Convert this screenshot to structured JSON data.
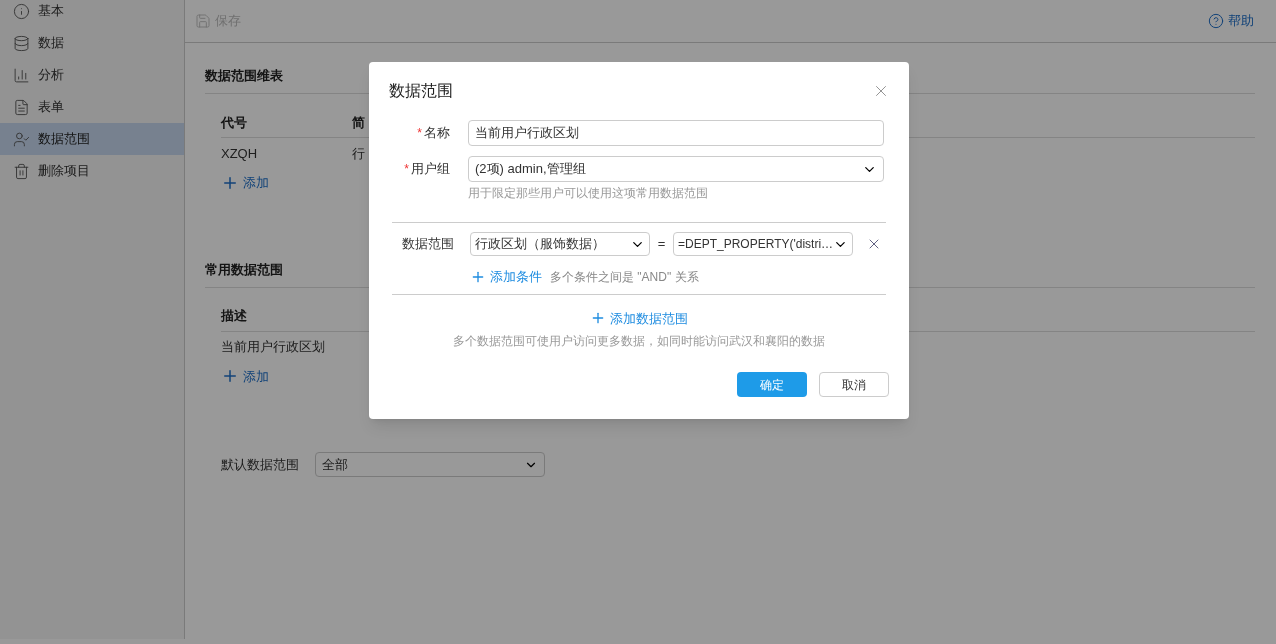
{
  "sidebar": {
    "items": [
      {
        "label": "基本",
        "selected": false
      },
      {
        "label": "数据",
        "selected": false
      },
      {
        "label": "分析",
        "selected": false
      },
      {
        "label": "表单",
        "selected": false
      },
      {
        "label": "数据范围",
        "selected": true
      },
      {
        "label": "删除项目",
        "selected": false
      }
    ]
  },
  "toolbar": {
    "save": {
      "label": "保存",
      "disabled": true
    },
    "help": "帮助"
  },
  "dimension_table": {
    "title": "数据范围维表",
    "columns": [
      "代号",
      "简"
    ],
    "rows": [
      [
        "XZQH",
        "行"
      ]
    ],
    "add": "添加"
  },
  "common_ranges": {
    "title": "常用数据范围",
    "columns": [
      "描述"
    ],
    "rows": [
      [
        "当前用户行政区划"
      ]
    ],
    "add": "添加"
  },
  "default_range": {
    "label": "默认数据范围",
    "value": "全部"
  },
  "dialog": {
    "title": "数据范围",
    "fields": [
      {
        "kind": "input",
        "label": "名称",
        "required_mark": "*",
        "value": "当前用户行政区划"
      },
      {
        "kind": "select",
        "label": "用户组",
        "required_mark": "*",
        "value": "(2项) admin,管理组",
        "hint": "用于限定那些用户可以使用这项常用数据范围"
      }
    ],
    "range": {
      "label": "数据范围",
      "field": "行政区划（服饰数据）",
      "operator": "=",
      "value": "=DEPT_PROPERTY('distri…",
      "add_condition": "添加条件",
      "condition_note": "多个条件之间是 \"AND\" 关系"
    },
    "add_range": "添加数据范围",
    "range_note": "多个数据范围可使用户访问更多数据，如同时能访问武汉和襄阳的数据",
    "buttons": [
      {
        "kind": "primary",
        "label": "确定"
      },
      {
        "kind": "default",
        "label": "取消"
      }
    ]
  }
}
